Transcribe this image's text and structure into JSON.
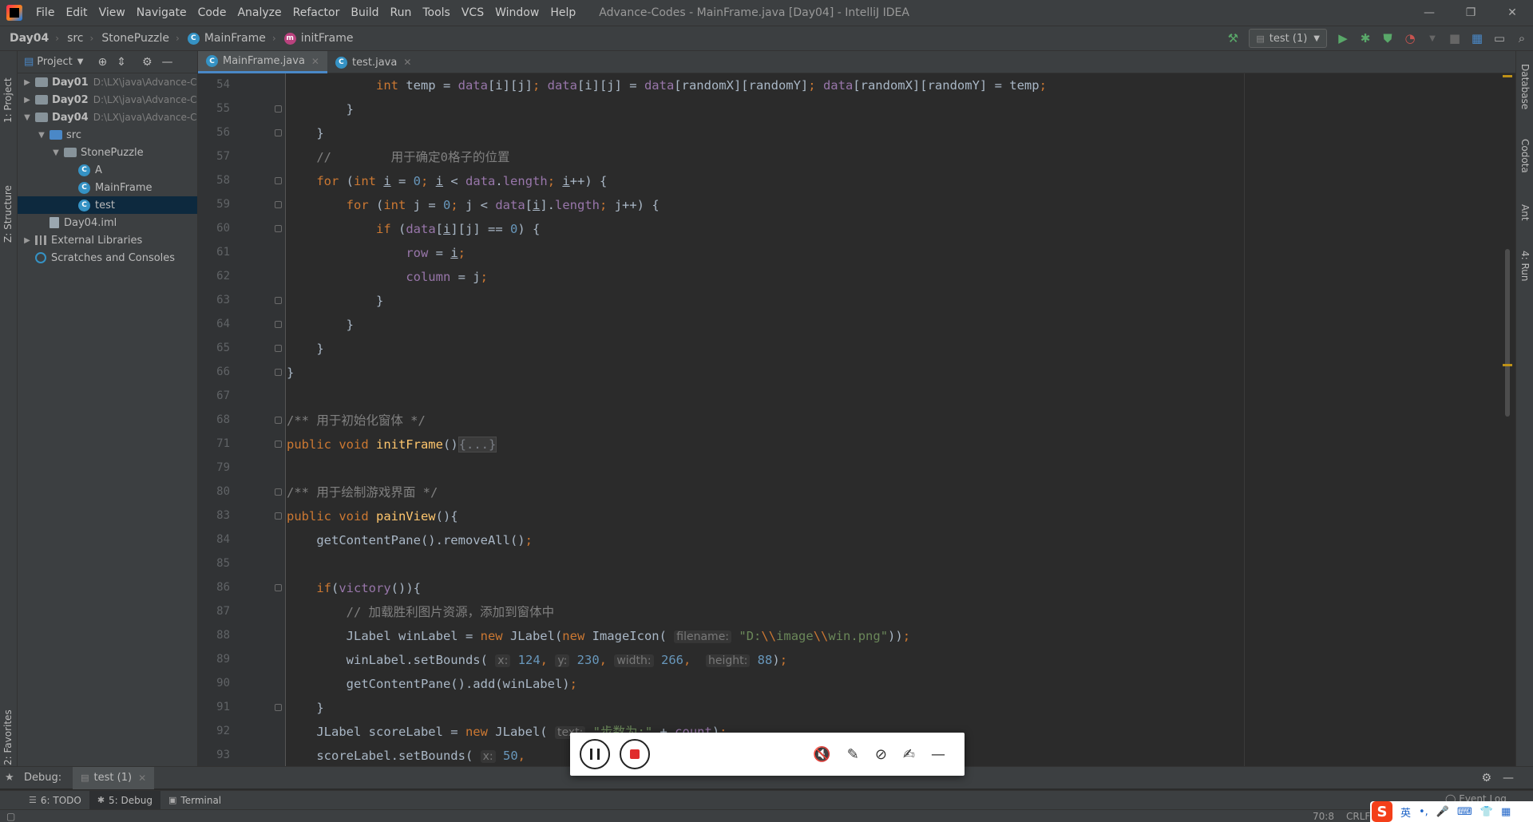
{
  "menu": {
    "items": [
      "File",
      "Edit",
      "View",
      "Navigate",
      "Code",
      "Analyze",
      "Refactor",
      "Build",
      "Run",
      "Tools",
      "VCS",
      "Window",
      "Help"
    ],
    "window_title": "Advance-Codes - MainFrame.java [Day04] - IntelliJ IDEA",
    "controls": [
      "—",
      "❐",
      "✕"
    ]
  },
  "breadcrumb": {
    "items": [
      "Day04",
      "src",
      "StonePuzzle",
      "MainFrame",
      "initFrame"
    ]
  },
  "toolbar": {
    "run_config": "test (1)"
  },
  "left_stripe": {
    "project_label": "1: Project",
    "structure_label": "Z: Structure",
    "favorites_label": "2: Favorites"
  },
  "project_panel": {
    "title": "Project",
    "tree": [
      {
        "label": "Day01",
        "path": "D:\\LX\\java\\Advance-C",
        "depth": 0,
        "kind": "module",
        "arrow": "▶"
      },
      {
        "label": "Day02",
        "path": "D:\\LX\\java\\Advance-C",
        "depth": 0,
        "kind": "module",
        "arrow": "▶"
      },
      {
        "label": "Day04",
        "path": "D:\\LX\\java\\Advance-C",
        "depth": 0,
        "kind": "module",
        "arrow": "▼"
      },
      {
        "label": "src",
        "path": "",
        "depth": 1,
        "kind": "src",
        "arrow": "▼"
      },
      {
        "label": "StonePuzzle",
        "path": "",
        "depth": 2,
        "kind": "package",
        "arrow": "▼"
      },
      {
        "label": "A",
        "path": "",
        "depth": 3,
        "kind": "class",
        "arrow": ""
      },
      {
        "label": "MainFrame",
        "path": "",
        "depth": 3,
        "kind": "class",
        "arrow": ""
      },
      {
        "label": "test",
        "path": "",
        "depth": 3,
        "kind": "class",
        "arrow": "",
        "selected": true
      },
      {
        "label": "Day04.iml",
        "path": "",
        "depth": 1,
        "kind": "file",
        "arrow": ""
      },
      {
        "label": "External Libraries",
        "path": "",
        "depth": 0,
        "kind": "lib",
        "arrow": "▶"
      },
      {
        "label": "Scratches and Consoles",
        "path": "",
        "depth": 0,
        "kind": "scratch",
        "arrow": ""
      }
    ]
  },
  "editor": {
    "tabs": [
      {
        "label": "MainFrame.java",
        "active": true
      },
      {
        "label": "test.java",
        "active": false
      }
    ],
    "lines": [
      {
        "num": "54",
        "html": "            <span class=\"k\">int </span>temp = <span class=\"f\">data</span>[i][j]<span class=\"k\">; </span><span class=\"f\">data</span>[i][j] = <span class=\"f\">data</span>[randomX][randomY]<span class=\"k\">; </span><span class=\"f\">data</span>[randomX][randomY] = temp<span class=\"k\">;</span>"
      },
      {
        "num": "55",
        "html": "        }"
      },
      {
        "num": "56",
        "html": "    }"
      },
      {
        "num": "57",
        "html": "    <span class=\"c\">//        用于确定0格子的位置</span>"
      },
      {
        "num": "58",
        "html": "    <span class=\"k\">for </span>(<span class=\"k\">int </span><span class=\"u\">i</span> = <span class=\"n\">0</span><span class=\"k\">; </span><span class=\"u\">i</span> &lt; <span class=\"f\">data</span>.<span class=\"f\">length</span><span class=\"k\">; </span><span class=\"u\">i</span>++) {"
      },
      {
        "num": "59",
        "html": "        <span class=\"k\">for </span>(<span class=\"k\">int </span>j = <span class=\"n\">0</span><span class=\"k\">; </span>j &lt; <span class=\"f\">data</span>[<span class=\"u\">i</span>].<span class=\"f\">length</span><span class=\"k\">; </span>j++) {"
      },
      {
        "num": "60",
        "html": "            <span class=\"k\">if </span>(<span class=\"f\">data</span>[<span class=\"u\">i</span>][j] == <span class=\"n\">0</span>) {"
      },
      {
        "num": "61",
        "html": "                <span class=\"f\">row</span> = <span class=\"u\">i</span><span class=\"k\">;</span>"
      },
      {
        "num": "62",
        "html": "                <span class=\"f\">column</span> = j<span class=\"k\">;</span>"
      },
      {
        "num": "63",
        "html": "            }"
      },
      {
        "num": "64",
        "html": "        }"
      },
      {
        "num": "65",
        "html": "    }"
      },
      {
        "num": "66",
        "html": "}"
      },
      {
        "num": "67",
        "html": ""
      },
      {
        "num": "68",
        "html": "<span class=\"c\">/** 用于初始化窗体 */</span>"
      },
      {
        "num": "71",
        "html": "<span class=\"k\">public void </span><span class=\"m\">initFrame</span>()<span class=\"fold-box\">{...}</span>"
      },
      {
        "num": "79",
        "html": ""
      },
      {
        "num": "80",
        "html": "<span class=\"c\">/** 用于绘制游戏界面 */</span>"
      },
      {
        "num": "83",
        "html": "<span class=\"k\">public void </span><span class=\"m\">painView</span>(){"
      },
      {
        "num": "84",
        "html": "    getContentPane().removeAll()<span class=\"k\">;</span>"
      },
      {
        "num": "85",
        "html": ""
      },
      {
        "num": "86",
        "html": "    <span class=\"k\">if</span>(<span class=\"f\">victory</span>()){"
      },
      {
        "num": "87",
        "html": "        <span class=\"c\">// 加载胜利图片资源，添加到窗体中</span>"
      },
      {
        "num": "88",
        "html": "        JLabel winLabel = <span class=\"k\">new </span>JLabel(<span class=\"k\">new </span>ImageIcon( <span class=\"hint\">filename:</span> <span class=\"s\">\"D:<span class=\"k\">\\\\</span>image<span class=\"k\">\\\\</span>win.png\"</span>))<span class=\"k\">;</span>"
      },
      {
        "num": "89",
        "html": "        winLabel.setBounds( <span class=\"hint\">x:</span> <span class=\"n\">124</span><span class=\"k\">, </span><span class=\"hint\">y:</span> <span class=\"n\">230</span><span class=\"k\">, </span><span class=\"hint\">width:</span> <span class=\"n\">266</span><span class=\"k\">,  </span><span class=\"hint\">height:</span> <span class=\"n\">88</span>)<span class=\"k\">;</span>"
      },
      {
        "num": "90",
        "html": "        getContentPane().add(winLabel)<span class=\"k\">;</span>"
      },
      {
        "num": "91",
        "html": "    }"
      },
      {
        "num": "92",
        "html": "    JLabel scoreLabel = <span class=\"k\">new </span>JLabel( <span class=\"hint\">text:</span> <span class=\"s\">\"步数为:\"</span> + <span class=\"f\">count</span>)<span class=\"k\">;</span>"
      },
      {
        "num": "93",
        "html": "    scoreLabel.setBounds( <span class=\"hint\">x:</span> <span class=\"n\">50</span><span class=\"k\">,</span>"
      }
    ]
  },
  "right_stripe": {
    "database_label": "Database",
    "codota_label": "Codota",
    "ant_label": "Ant",
    "run_label": "4: Run"
  },
  "debug": {
    "label": "Debug:",
    "tab": "test (1)"
  },
  "bottom_tools": [
    {
      "icon": "☰",
      "label": "6: TODO",
      "active": false
    },
    {
      "icon": "✱",
      "label": "5: Debug",
      "active": true
    },
    {
      "icon": "▣",
      "label": "Terminal",
      "active": false
    }
  ],
  "status": {
    "event_log": "Event Log",
    "position": "70:8",
    "line_sep": "CRLF"
  },
  "ime": {
    "logo": "S",
    "lang": "英",
    "punct": "•,",
    "mic": "🎤",
    "kbd": "⌨",
    "shirt": "👕",
    "grid": "▦"
  }
}
